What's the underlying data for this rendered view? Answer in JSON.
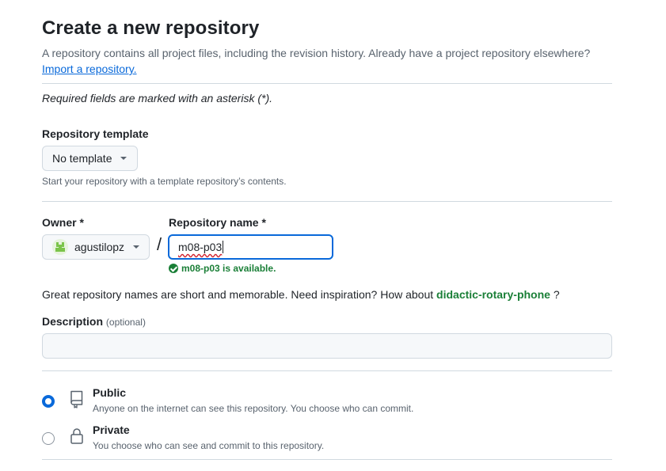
{
  "page": {
    "title": "Create a new repository",
    "intro": "A repository contains all project files, including the revision history. Already have a project repository elsewhere?",
    "import_link": "Import a repository.",
    "required_note": "Required fields are marked with an asterisk (*)."
  },
  "template": {
    "label": "Repository template",
    "selected": "No template",
    "help": "Start your repository with a template repository’s contents."
  },
  "owner": {
    "label": "Owner *",
    "value": "agustilopz"
  },
  "repo_name": {
    "label": "Repository name *",
    "value": "m08-p03",
    "availability": "m08-p03 is available."
  },
  "inspiration": {
    "text": "Great repository names are short and memorable. Need inspiration? How about",
    "suggestion": "didactic-rotary-phone",
    "end": "?"
  },
  "description": {
    "label": "Description",
    "optional": "(optional)",
    "value": ""
  },
  "visibility": {
    "options": [
      {
        "title": "Public",
        "desc": "Anyone on the internet can see this repository. You choose who can commit.",
        "selected": true
      },
      {
        "title": "Private",
        "desc": "You choose who can see and commit to this repository.",
        "selected": false
      }
    ]
  },
  "colors": {
    "accent": "#0969da",
    "success": "#1a7f37",
    "border": "#d1d9e0",
    "muted": "#59636e"
  },
  "icons": {
    "public": "repo-icon",
    "private": "lock-icon",
    "check": "check-circle-icon",
    "dropdown": "triangle-down-icon"
  }
}
